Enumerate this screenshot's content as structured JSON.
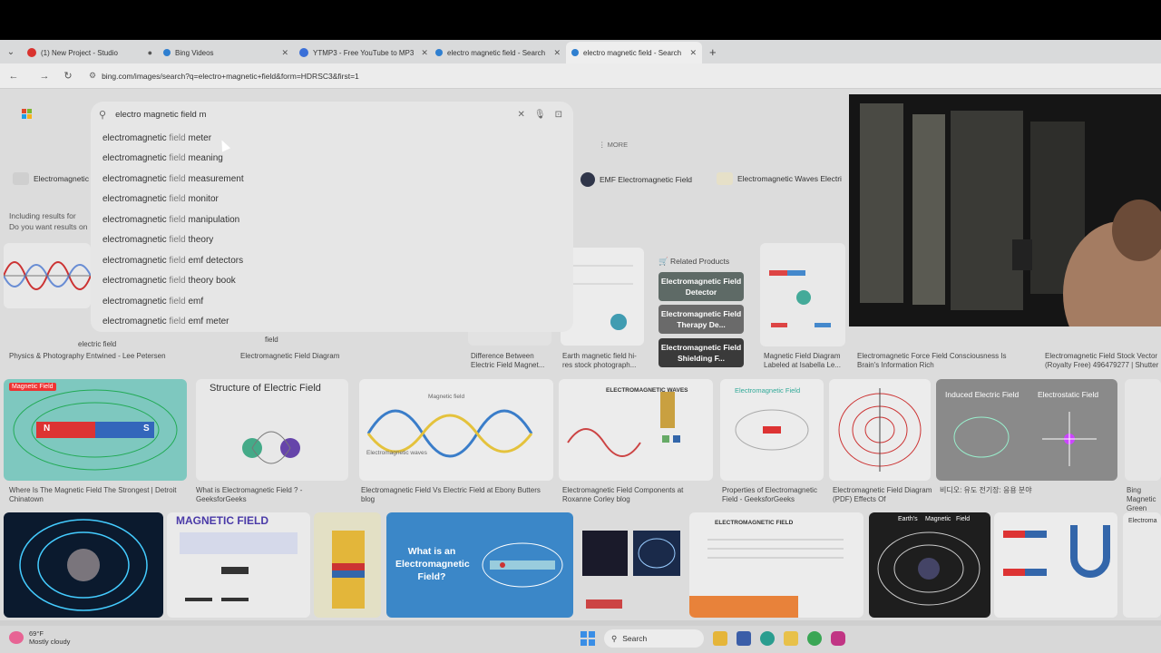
{
  "browser": {
    "tabs": [
      {
        "label": "(1) New Project - Studio",
        "color": "#d9322e"
      },
      {
        "label": "Bing Videos",
        "color": "#2f7fd0"
      },
      {
        "label": "YTMP3 - Free YouTube to MP3",
        "color": "#3a6fd8"
      },
      {
        "label": "electro magnetic field - Search",
        "color": "#2f7fd0"
      },
      {
        "label": "electro magnetic field - Search",
        "color": "#2f7fd0"
      }
    ],
    "url": "bing.com/images/search?q=electro+magnetic+field&form=HDRSC3&first=1"
  },
  "search": {
    "query": "electro magnetic field m",
    "suggestions": [
      {
        "base": "electromagnetic ",
        "light": "field ",
        "rest": "meter"
      },
      {
        "base": "electromagnetic ",
        "light": "field ",
        "rest": "meaning"
      },
      {
        "base": "electromagnetic ",
        "light": "field ",
        "rest": "measurement"
      },
      {
        "base": "electromagnetic ",
        "light": "field ",
        "rest": "monitor"
      },
      {
        "base": "electromagnetic ",
        "light": "field ",
        "rest": "manipulation"
      },
      {
        "base": "electromagnetic ",
        "light": "field ",
        "rest": "theory"
      },
      {
        "base": "electromagnetic ",
        "light": "field ",
        "rest": "emf detectors"
      },
      {
        "base": "electromagnetic ",
        "light": "field ",
        "rest": "theory book"
      },
      {
        "base": "electromagnetic ",
        "light": "field ",
        "rest": "emf"
      },
      {
        "base": "electromagnetic ",
        "light": "field ",
        "rest": "emf meter"
      }
    ],
    "more_label": "MORE"
  },
  "chips": {
    "left": "Electromagnetic",
    "emf": "EMF Electromagnetic Field",
    "waves": "Electromagnetic Waves Electri"
  },
  "including": {
    "line1": "Including results for",
    "line2": "Do you want results on"
  },
  "related": {
    "title": "Related Products",
    "items": [
      {
        "label": "Electromagnetic Field Detector",
        "color": "#5e6a66"
      },
      {
        "label": "Electromagnetic Field Therapy De...",
        "color": "#6a6a6a"
      },
      {
        "label": "Electromagnetic Field Shielding F...",
        "color": "#3a3a3a"
      }
    ]
  },
  "row1": {
    "captions": [
      "Physics & Photography Entwined - Lee Petersen",
      "Electromagnetic Field Diagram",
      "Difference Between Electric Field Magnet...",
      "Earth magnetic field hi-res stock photograph...",
      "Magnetic Field Diagram Labeled at Isabella Le...",
      "Electromagnetic Force Field Consciousness Is Brain's Information Rich",
      "Electromagnetic Field Stock Vector (Royalty Free) 496479277 | Shutter"
    ],
    "labels": {
      "electric": "electric field",
      "field": "field"
    }
  },
  "row2": {
    "tiles": [
      {
        "title": "Magnetic Field",
        "n": "N",
        "s": "S",
        "caption": "Where Is The Magnetic Field The Strongest | Detroit Chinatown"
      },
      {
        "title": "Structure of Electric Field",
        "caption": "What is Electromagnetic Field ? - GeeksforGeeks"
      },
      {
        "title": "Magnetic field",
        "sub": "Electromagnetic waves",
        "caption": "Electromagnetic Field Vs Electric Field at Ebony Butters blog"
      },
      {
        "title": "ELECTROMAGNETIC WAVES",
        "caption": "Electromagnetic Field Components at Roxanne Corley blog"
      },
      {
        "title": "Electromagnetic Field",
        "caption": "Properties of Electromagnetic Field - GeeksforGeeks"
      },
      {
        "caption": "Electromagnetic Field Diagram (PDF) Effects Of"
      },
      {
        "title1": "Induced Electric Field",
        "title2": "Electrostatic Field",
        "caption": "비디오: 유도 전기장: 응용 분야"
      },
      {
        "caption": "Bing Magnetic Green Ma..."
      }
    ]
  },
  "row3": {
    "magnetic_field": "MAGNETIC FIELD",
    "what_is": "What is an Electromagnetic Field?",
    "emf_label": "ELECTROMAGNETIC FIELD",
    "earth_tile": {
      "a": "Earth's",
      "b": "Magnetic",
      "c": "Field"
    },
    "last": "Electroma"
  },
  "taskbar": {
    "temp": "69°F",
    "condition": "Mostly cloudy",
    "search": "Search"
  }
}
